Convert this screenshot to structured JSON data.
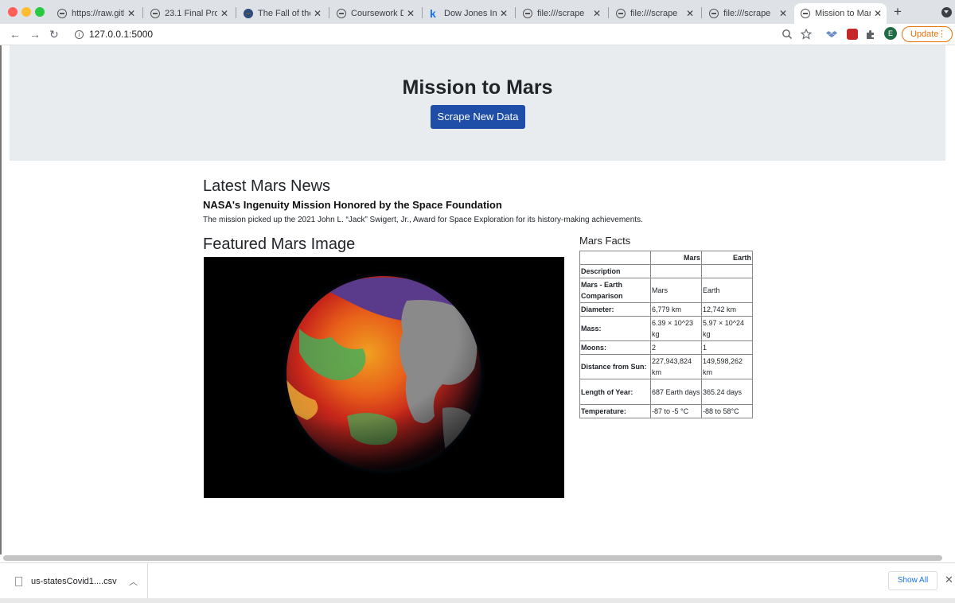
{
  "browser": {
    "tabs": [
      {
        "label": "https://raw.gith",
        "favicon": "globe-icon"
      },
      {
        "label": "23.1 Final Proje",
        "favicon": "globe-icon"
      },
      {
        "label": "The Fall of the ",
        "favicon": "site-logo-icon"
      },
      {
        "label": "Coursework De",
        "favicon": "globe-icon"
      },
      {
        "label": "Dow Jones Ind",
        "favicon": "k-logo-icon"
      },
      {
        "label": "file:///scrape",
        "favicon": "globe-icon"
      },
      {
        "label": "file:///scrape",
        "favicon": "globe-icon"
      },
      {
        "label": "file:///scrape",
        "favicon": "globe-icon"
      },
      {
        "label": "Mission to Mar",
        "favicon": "globe-icon",
        "active": true
      }
    ],
    "url": "127.0.0.1:5000",
    "profile_initial": "E",
    "update_label": "Update",
    "accent_update": "#e8710a"
  },
  "page": {
    "title": "Mission to Mars",
    "scrape_button": "Scrape New Data",
    "news_heading": "Latest Mars News",
    "news_title": "NASA's Ingenuity Mission Honored by the Space Foundation",
    "news_paragraph": "The mission picked up the 2021 John L. “Jack” Swigert, Jr., Award for Space Exploration for its history-making achievements.",
    "image_heading": "Featured Mars Image",
    "facts_heading": "Mars Facts",
    "facts_table": {
      "header": [
        "",
        "Mars",
        "Earth"
      ],
      "rows": [
        [
          "Description",
          "",
          ""
        ],
        [
          "Mars - Earth Comparison",
          "Mars",
          "Earth"
        ],
        [
          "Diameter:",
          "6,779 km",
          "12,742 km"
        ],
        [
          "Mass:",
          "6.39 × 10^23 kg",
          "5.97 × 10^24 kg"
        ],
        [
          "Moons:",
          "2",
          "1"
        ],
        [
          "Distance from Sun:",
          "227,943,824 km",
          "149,598,262 km"
        ],
        [
          "Length of Year:",
          "687 Earth days",
          "365.24 days"
        ],
        [
          "Temperature:",
          "-87 to -5 °C",
          "-88 to 58°C"
        ]
      ]
    },
    "button_color": "#1e4ea8"
  },
  "downloads": {
    "file_name": "us-statesCovid1....csv",
    "show_all": "Show All"
  }
}
